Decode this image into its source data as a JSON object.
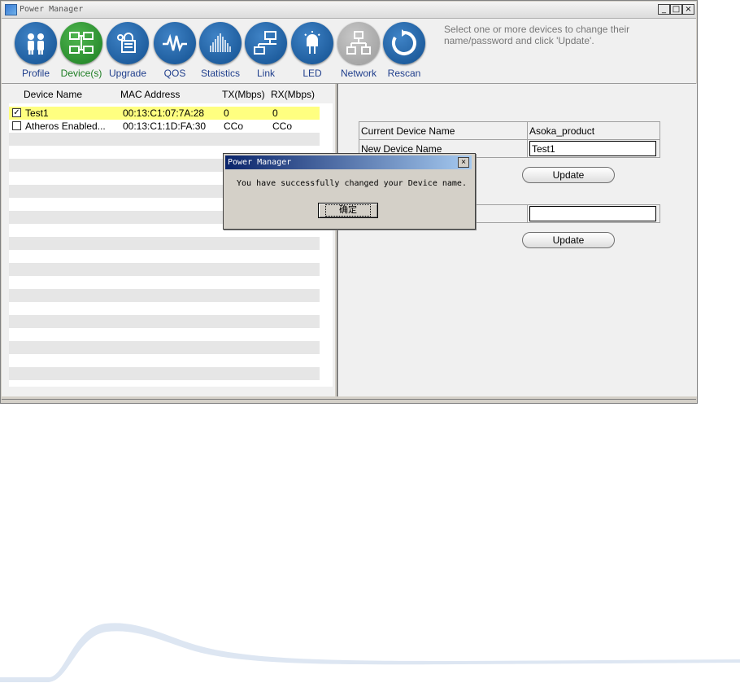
{
  "window": {
    "title": "Power Manager",
    "buttons": {
      "minimize": "_",
      "maximize": "□",
      "close": "×"
    }
  },
  "toolbar": {
    "items": [
      {
        "label": "Profile",
        "icon": "people-icon"
      },
      {
        "label": "Device(s)",
        "icon": "network-computers-icon",
        "active": true
      },
      {
        "label": "Upgrade",
        "icon": "lock-upgrade-icon"
      },
      {
        "label": "QOS",
        "icon": "waveform-icon"
      },
      {
        "label": "Statistics",
        "icon": "bar-statistics-icon"
      },
      {
        "label": "Link",
        "icon": "link-computer-icon"
      },
      {
        "label": "LED",
        "icon": "led-bulb-icon"
      },
      {
        "label": "Network",
        "icon": "network-tree-icon",
        "disabled": true
      },
      {
        "label": "Rescan",
        "icon": "rescan-arrow-icon"
      }
    ],
    "hint": "Select one or more devices to change their name/password and click 'Update'."
  },
  "devices": {
    "headers": {
      "name": "Device Name",
      "mac": "MAC Address",
      "tx": "TX(Mbps)",
      "rx": "RX(Mbps)"
    },
    "rows": [
      {
        "checked": true,
        "name": "Test1",
        "mac": "00:13:C1:07:7A:28",
        "tx": "0",
        "rx": "0"
      },
      {
        "checked": false,
        "name": "Atheros Enabled...",
        "mac": "00:13:C1:1D:FA:30",
        "tx": "CCo",
        "rx": "CCo"
      }
    ]
  },
  "details": {
    "current_name_label": "Current Device Name",
    "current_name_value": "Asoka_product",
    "new_name_label": "New Device Name",
    "new_name_value": "Test1",
    "update_label": "Update",
    "password_value": "",
    "update2_label": "Update"
  },
  "dialog": {
    "title": "Power Manager",
    "message": "You have successfully changed your Device name.",
    "ok_label": "确定",
    "close_glyph": "×"
  },
  "colors": {
    "selected_row": "#ffff80",
    "toolbar_icon": "#1f5fa0",
    "active_icon": "#1c7d22",
    "dialog_title": "#0a246a"
  }
}
